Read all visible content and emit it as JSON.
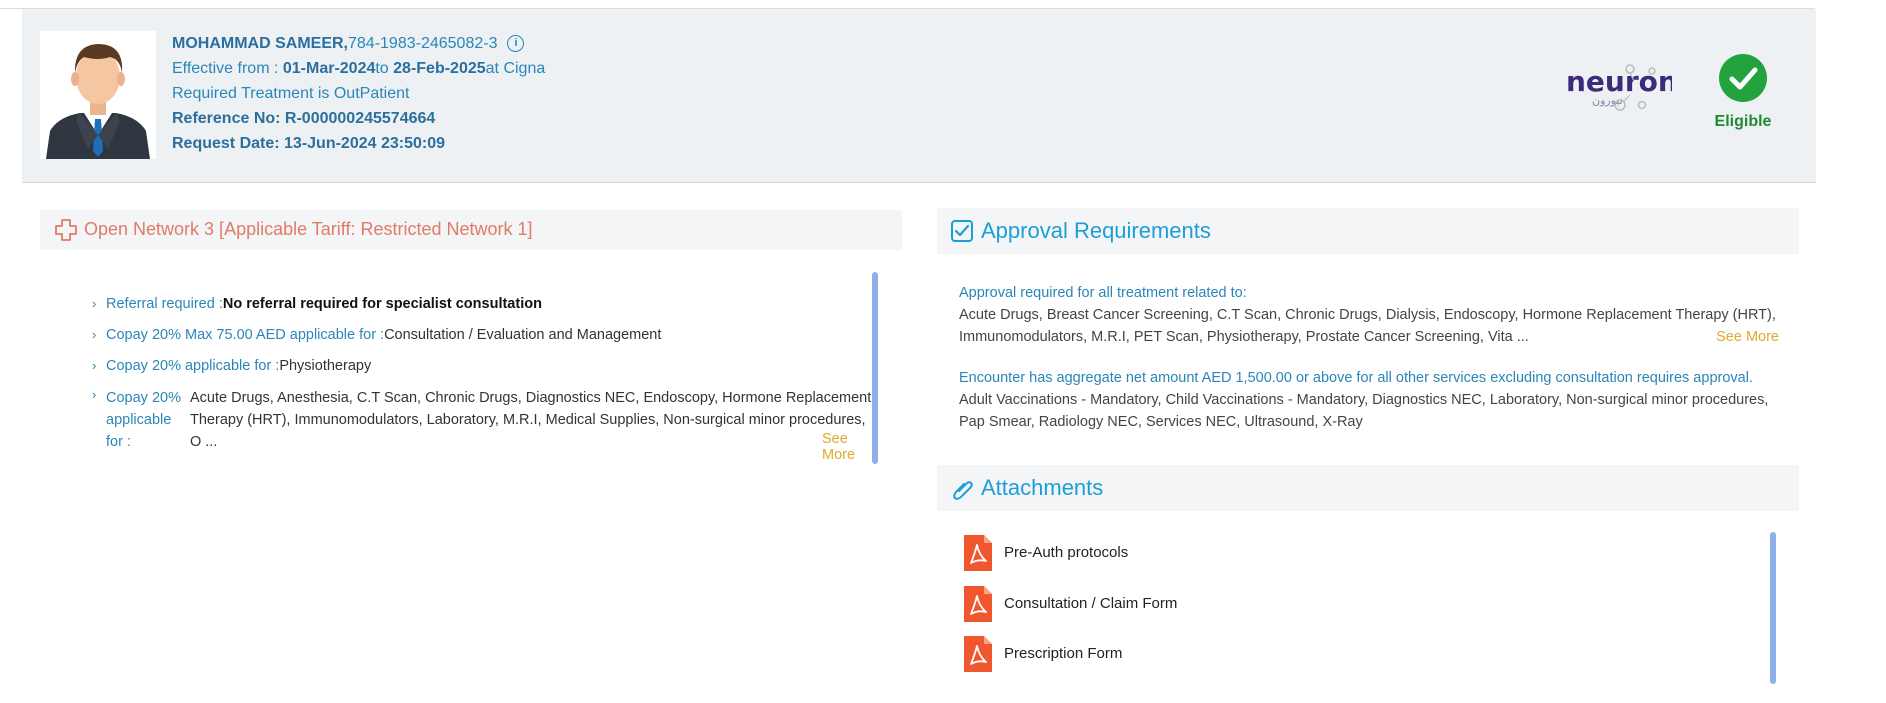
{
  "patient": {
    "name": "MOHAMMAD SAMEER,",
    "emirates_id": "784-1983-2465082-3",
    "effective_prefix": "Effective from : ",
    "effective_from": "01-Mar-2024",
    "to_word": "to ",
    "effective_to": "28-Feb-2025",
    "at_insurer": "at Cigna",
    "treatment": "Required Treatment is OutPatient",
    "reference": "Reference No: R-000000245574664",
    "request_date": "Request Date: 13-Jun-2024 23:50:09"
  },
  "logo": {
    "latin": "neuron",
    "arabic": "نيورون"
  },
  "status": {
    "label": "Eligible",
    "color": "#22a33d"
  },
  "network": {
    "title": "Open Network 3 [Applicable Tariff: Restricted Network 1]",
    "rules": [
      {
        "label": "Referral required :",
        "value": "No referral required for specialist consultation"
      },
      {
        "label": "Copay 20% Max 75.00 AED applicable for :",
        "value": "Consultation / Evaluation and Management"
      },
      {
        "label": "Copay 20% applicable for :",
        "value": "Physiotherapy"
      },
      {
        "label": "Copay 20% applicable for :",
        "value": "Acute Drugs, Anesthesia, C.T Scan, Chronic Drugs, Diagnostics NEC, Endoscopy, Hormone Replacement Therapy (HRT), Immunomodulators, Laboratory, M.R.I, Medical Supplies, Non-surgical minor procedures, O ..."
      }
    ],
    "see_more": "See More"
  },
  "approval": {
    "title": "Approval Requirements",
    "block1_heading": "Approval required for all treatment related to:",
    "block1_text": "Acute Drugs, Breast Cancer Screening, C.T Scan, Chronic Drugs, Dialysis, Endoscopy, Hormone Replacement Therapy (HRT), Immunomodulators, M.R.I, PET Scan, Physiotherapy, Prostate Cancer Screening, Vita ...",
    "see_more": "See More",
    "block2_heading": "Encounter has aggregate net amount AED 1,500.00 or above for all other services excluding consultation requires approval.",
    "block2_text": "Adult Vaccinations - Mandatory, Child Vaccinations - Mandatory, Diagnostics NEC, Laboratory, Non-surgical minor procedures, Pap Smear, Radiology NEC, Services NEC, Ultrasound, X-Ray"
  },
  "attachments": {
    "title": "Attachments",
    "items": [
      "Pre-Auth protocols",
      "Consultation / Claim Form",
      "Prescription Form"
    ]
  }
}
